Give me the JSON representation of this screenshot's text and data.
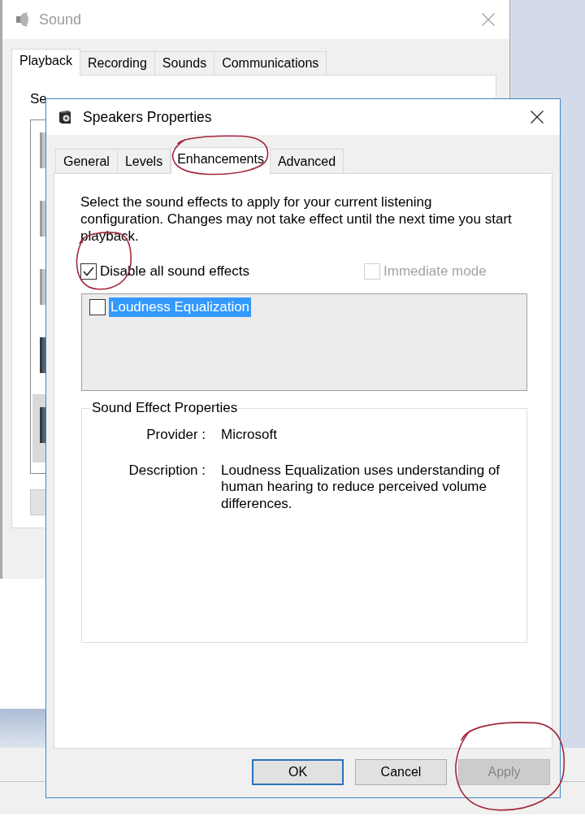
{
  "sound_window": {
    "title": "Sound",
    "tabs": [
      {
        "label": "Playback",
        "selected": true
      },
      {
        "label": "Recording",
        "selected": false
      },
      {
        "label": "Sounds",
        "selected": false
      },
      {
        "label": "Communications",
        "selected": false
      }
    ],
    "instruction": "Se",
    "devices": [
      {
        "disabled": true,
        "selected": false
      },
      {
        "disabled": true,
        "selected": false
      },
      {
        "disabled": true,
        "selected": false
      },
      {
        "disabled": false,
        "selected": false
      },
      {
        "disabled": false,
        "selected": true
      }
    ]
  },
  "dialog": {
    "title": "Speakers Properties",
    "tabs": [
      {
        "label": "General",
        "selected": false,
        "circled": false
      },
      {
        "label": "Levels",
        "selected": false,
        "circled": false
      },
      {
        "label": "Enhancements",
        "selected": true,
        "circled": true
      },
      {
        "label": "Advanced",
        "selected": false,
        "circled": false
      }
    ],
    "instructions": "Select the sound effects to apply for your current listening configuration. Changes may not take effect until the next time you start playback.",
    "options": [
      {
        "label": "Disable all sound effects",
        "checked": true,
        "disabled": false,
        "circled": true
      },
      {
        "label": "Immediate mode",
        "checked": false,
        "disabled": true,
        "circled": false
      }
    ],
    "effects": [
      {
        "label": "Loudness Equalization",
        "checked": false,
        "selected": true
      }
    ],
    "properties": {
      "title": "Sound Effect Properties",
      "fields": [
        {
          "label": "Provider :",
          "value": "Microsoft"
        },
        {
          "label": "Description :",
          "value": "Loudness Equalization uses understanding of human hearing to reduce perceived volume differences."
        }
      ]
    },
    "buttons": [
      {
        "label": "OK",
        "default": true,
        "disabled": false,
        "circled": false
      },
      {
        "label": "Cancel",
        "default": false,
        "disabled": false,
        "circled": false
      },
      {
        "label": "Apply",
        "default": false,
        "disabled": true,
        "circled": true
      }
    ]
  }
}
